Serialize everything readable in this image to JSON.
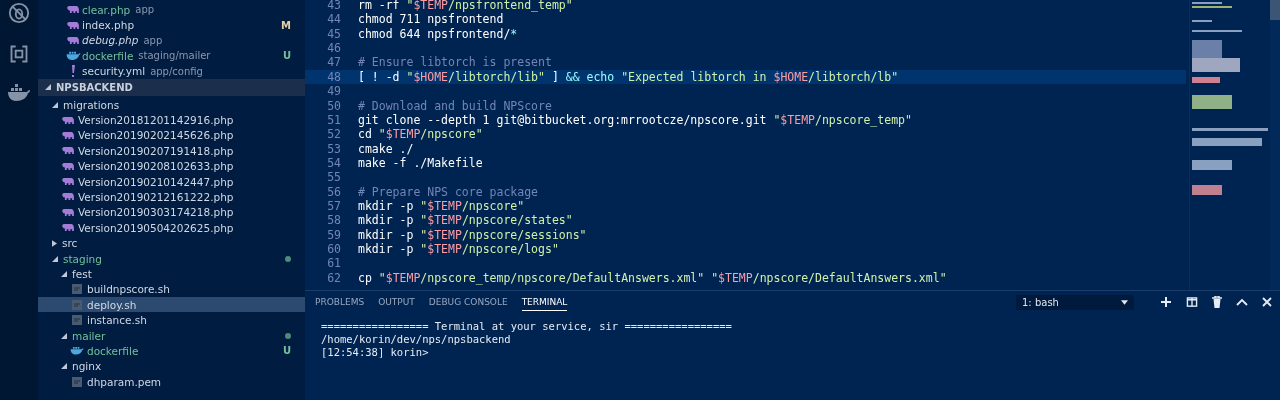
{
  "activity_bar": {
    "items": [
      {
        "kind": "debug",
        "selected": false
      },
      {
        "kind": "extensions",
        "selected": false
      },
      {
        "kind": "docker",
        "selected": false
      }
    ]
  },
  "explorer": {
    "open_editors": [
      {
        "name": "clear.php",
        "detail": "app",
        "kind": "php",
        "untracked": true,
        "preview": false,
        "selected": false
      },
      {
        "name": "index.php",
        "kind": "php",
        "untracked": false,
        "preview": false,
        "badge": "M",
        "selected": false
      },
      {
        "name": "debug.php",
        "detail": "app",
        "kind": "php",
        "untracked": false,
        "preview": true,
        "selected": false
      },
      {
        "name": "dockerfile",
        "detail": "staging/mailer",
        "kind": "docker",
        "untracked": true,
        "preview": false,
        "badge": "U",
        "selected": false
      },
      {
        "name": "security.yml",
        "detail": "app/config",
        "kind": "yaml",
        "untracked": false,
        "preview": false,
        "selected": false
      }
    ],
    "section": {
      "title": "NPSBACKEND"
    },
    "tree": [
      {
        "name": "migrations",
        "kind": "folder",
        "expanded": true,
        "untracked": false,
        "selected": false,
        "children": [
          {
            "name": "Version20181201142916.php",
            "kind": "php",
            "untracked": false,
            "selected": false
          },
          {
            "name": "Version20190202145626.php",
            "kind": "php",
            "untracked": false,
            "selected": false
          },
          {
            "name": "Version20190207191418.php",
            "kind": "php",
            "untracked": false,
            "selected": false
          },
          {
            "name": "Version20190208102633.php",
            "kind": "php",
            "untracked": false,
            "selected": false
          },
          {
            "name": "Version20190210142447.php",
            "kind": "php",
            "untracked": false,
            "selected": false
          },
          {
            "name": "Version20190212161222.php",
            "kind": "php",
            "untracked": false,
            "selected": false
          },
          {
            "name": "Version20190303174218.php",
            "kind": "php",
            "untracked": false,
            "selected": false
          },
          {
            "name": "Version20190504202625.php",
            "kind": "php",
            "untracked": false,
            "selected": false
          }
        ]
      },
      {
        "name": "src",
        "kind": "folder",
        "expanded": false,
        "untracked": false,
        "selected": false
      },
      {
        "name": "staging",
        "kind": "folder",
        "expanded": true,
        "untracked": true,
        "dot": true,
        "selected": false,
        "children": [
          {
            "name": "fest",
            "kind": "folder",
            "expanded": true,
            "untracked": false,
            "selected": false,
            "children": [
              {
                "name": "buildnpscore.sh",
                "kind": "shell",
                "untracked": false,
                "selected": false
              },
              {
                "name": "deploy.sh",
                "kind": "shell",
                "untracked": false,
                "selected": true
              },
              {
                "name": "instance.sh",
                "kind": "shell",
                "untracked": false,
                "selected": false
              }
            ]
          },
          {
            "name": "mailer",
            "kind": "folder",
            "expanded": true,
            "untracked": true,
            "dot": true,
            "selected": false,
            "children": [
              {
                "name": "dockerfile",
                "kind": "docker",
                "untracked": true,
                "badge": "U",
                "selected": false
              }
            ]
          },
          {
            "name": "nginx",
            "kind": "folder",
            "expanded": true,
            "untracked": false,
            "selected": false,
            "children": [
              {
                "name": "dhparam.pem",
                "kind": "shell",
                "untracked": false,
                "selected": false
              }
            ]
          }
        ]
      }
    ]
  },
  "editor": {
    "lines": [
      {
        "num": "43",
        "current": false,
        "segs": [
          {
            "kind": "plain",
            "text": "rm -rf "
          },
          {
            "kind": "str",
            "text": "\""
          },
          {
            "kind": "var",
            "text": "$TEMP"
          },
          {
            "kind": "str",
            "text": "/npsfrontend_temp\""
          }
        ]
      },
      {
        "num": "44",
        "current": false,
        "segs": [
          {
            "kind": "plain",
            "text": "chmod 711 npsfrontend"
          }
        ]
      },
      {
        "num": "45",
        "current": false,
        "segs": [
          {
            "kind": "plain",
            "text": "chmod 644 npsfrontend/"
          },
          {
            "kind": "op",
            "text": "*"
          }
        ]
      },
      {
        "num": "46",
        "current": false
      },
      {
        "num": "47",
        "current": false,
        "segs": [
          {
            "kind": "comment",
            "text": "# Ensure libtorch is present"
          }
        ]
      },
      {
        "num": "48",
        "current": true,
        "segs": [
          {
            "kind": "plain",
            "text": "[ ! -d "
          },
          {
            "kind": "str",
            "text": "\""
          },
          {
            "kind": "var",
            "text": "$HOME"
          },
          {
            "kind": "str",
            "text": "/libtorch/lib\""
          },
          {
            "kind": "plain",
            "text": " ] "
          },
          {
            "kind": "op",
            "text": "&& echo"
          },
          {
            "kind": "str",
            "text": " \"Expected libtorch in "
          },
          {
            "kind": "var",
            "text": "$HOME"
          },
          {
            "kind": "str",
            "text": "/libtorch/lb\""
          }
        ]
      },
      {
        "num": "49",
        "current": false
      },
      {
        "num": "50",
        "current": false,
        "segs": [
          {
            "kind": "comment",
            "text": "# Download and build NPScore"
          }
        ]
      },
      {
        "num": "51",
        "current": false,
        "segs": [
          {
            "kind": "plain",
            "text": "git clone --depth 1 git@bitbucket.org:mrrootcze/npscore.git "
          },
          {
            "kind": "str",
            "text": "\""
          },
          {
            "kind": "var",
            "text": "$TEMP"
          },
          {
            "kind": "str",
            "text": "/npscore_temp\""
          }
        ]
      },
      {
        "num": "52",
        "current": false,
        "segs": [
          {
            "kind": "plain",
            "text": "cd "
          },
          {
            "kind": "str",
            "text": "\""
          },
          {
            "kind": "var",
            "text": "$TEMP"
          },
          {
            "kind": "str",
            "text": "/npscore\""
          }
        ]
      },
      {
        "num": "53",
        "current": false,
        "segs": [
          {
            "kind": "plain",
            "text": "cmake ./"
          }
        ]
      },
      {
        "num": "54",
        "current": false,
        "segs": [
          {
            "kind": "plain",
            "text": "make -f ./Makefile"
          }
        ]
      },
      {
        "num": "55",
        "current": false
      },
      {
        "num": "56",
        "current": false,
        "segs": [
          {
            "kind": "comment",
            "text": "# Prepare NPS core package"
          }
        ]
      },
      {
        "num": "57",
        "current": false,
        "segs": [
          {
            "kind": "plain",
            "text": "mkdir -p "
          },
          {
            "kind": "str",
            "text": "\""
          },
          {
            "kind": "var",
            "text": "$TEMP"
          },
          {
            "kind": "str",
            "text": "/npscore\""
          }
        ]
      },
      {
        "num": "58",
        "current": false,
        "segs": [
          {
            "kind": "plain",
            "text": "mkdir -p "
          },
          {
            "kind": "str",
            "text": "\""
          },
          {
            "kind": "var",
            "text": "$TEMP"
          },
          {
            "kind": "str",
            "text": "/npscore/states\""
          }
        ]
      },
      {
        "num": "59",
        "current": false,
        "segs": [
          {
            "kind": "plain",
            "text": "mkdir -p "
          },
          {
            "kind": "str",
            "text": "\""
          },
          {
            "kind": "var",
            "text": "$TEMP"
          },
          {
            "kind": "str",
            "text": "/npscore/sessions\""
          }
        ]
      },
      {
        "num": "60",
        "current": false,
        "segs": [
          {
            "kind": "plain",
            "text": "mkdir -p "
          },
          {
            "kind": "str",
            "text": "\""
          },
          {
            "kind": "var",
            "text": "$TEMP"
          },
          {
            "kind": "str",
            "text": "/npscore/logs\""
          }
        ]
      },
      {
        "num": "61",
        "current": false
      },
      {
        "num": "62",
        "current": false,
        "segs": [
          {
            "kind": "plain",
            "text": "cp "
          },
          {
            "kind": "str",
            "text": "\""
          },
          {
            "kind": "var",
            "text": "$TEMP"
          },
          {
            "kind": "str",
            "text": "/npscore_temp/npscore/DefaultAnswers.xml\""
          },
          {
            "kind": "str",
            "text": " \""
          },
          {
            "kind": "var",
            "text": "$TEMP"
          },
          {
            "kind": "str",
            "text": "/npscore/DefaultAnswers.xml\""
          }
        ]
      }
    ]
  },
  "panel": {
    "tabs": [
      {
        "label": "PROBLEMS",
        "selected": false
      },
      {
        "label": "OUTPUT",
        "selected": false
      },
      {
        "label": "DEBUG CONSOLE",
        "selected": false
      },
      {
        "label": "TERMINAL",
        "selected": true
      }
    ],
    "terminal_select": {
      "value": "1: bash"
    },
    "actions": [
      {
        "kind": "add"
      },
      {
        "kind": "split"
      },
      {
        "kind": "trash"
      },
      {
        "kind": "maximize"
      },
      {
        "kind": "close"
      }
    ],
    "terminal_lines": [
      "================= Terminal at your service, sir =================",
      "/home/korin/dev/nps/npsbackend",
      "[12:54:38] korin>"
    ]
  }
}
